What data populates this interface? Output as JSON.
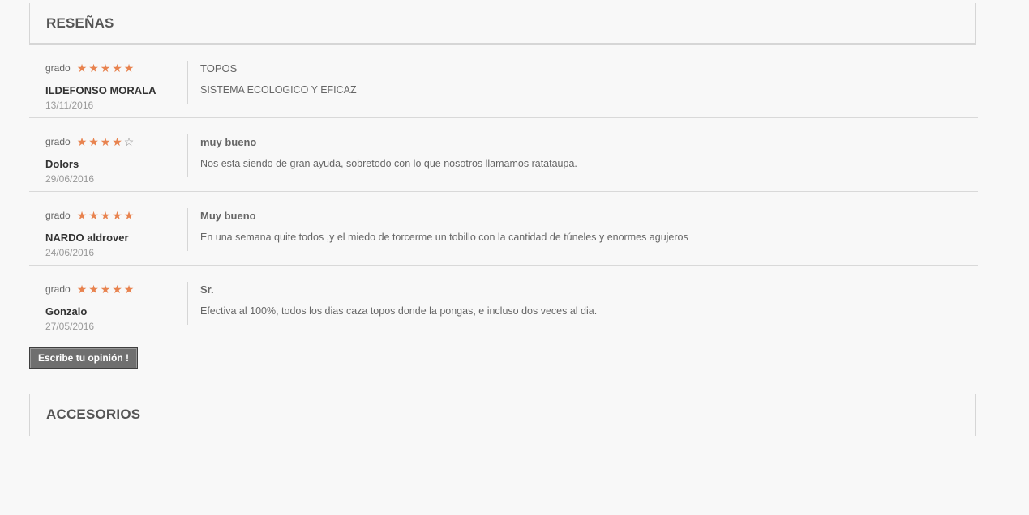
{
  "reviews_section": {
    "title": "RESEÑAS"
  },
  "reviews": [
    {
      "grade_label": "grado",
      "rating": 5,
      "author": "ILDEFONSO MORALA",
      "date": "13/11/2016",
      "title": "TOPOS",
      "body": "SISTEMA ECOLOGICO Y EFICAZ"
    },
    {
      "grade_label": "grado",
      "rating": 4,
      "author": "Dolors",
      "date": "29/06/2016",
      "title": "muy bueno",
      "body": "Nos esta siendo de gran ayuda, sobretodo con lo que nosotros llamamos ratataupa."
    },
    {
      "grade_label": "grado",
      "rating": 5,
      "author": "NARDO aldrover",
      "date": "24/06/2016",
      "title": "Muy bueno",
      "body": "En una semana quite todos ,y el miedo de torcerme un tobillo con la cantidad de túneles y enormes agujeros"
    },
    {
      "grade_label": "grado",
      "rating": 5,
      "author": "Gonzalo",
      "date": "27/05/2016",
      "title": "Sr.",
      "body": "Efectiva al 100%, todos los dias caza topos donde la pongas, e incluso dos veces al dia."
    }
  ],
  "star_max": 5,
  "colors": {
    "star_filled": "#e8834f",
    "star_empty": "#888888",
    "button_bg": "#6f6f6f"
  },
  "write_review_button": {
    "label": "Escribe tu opinión !"
  },
  "accessories_section": {
    "title": "ACCESORIOS"
  }
}
